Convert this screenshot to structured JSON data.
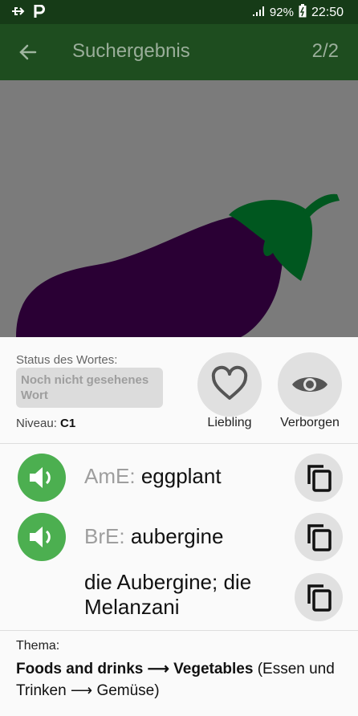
{
  "status_bar": {
    "icons": [
      "usb-icon",
      "parking-icon",
      "signal-icon",
      "battery-icon"
    ],
    "battery": "92%",
    "time": "22:50"
  },
  "app_bar": {
    "title": "Suchergebnis",
    "counter": "2/2"
  },
  "word_status": {
    "label": "Status des Wortes:",
    "value": "Noch nicht gesehenes Wort",
    "level_label": "Niveau:",
    "level_value": "C1"
  },
  "actions": {
    "favorite_label": "Liebling",
    "hidden_label": "Verborgen"
  },
  "translations": [
    {
      "prefix": "AmE:",
      "word": "eggplant"
    },
    {
      "prefix": "BrE:",
      "word": "aubergine"
    }
  ],
  "german": "die Aubergine; die Melanzani",
  "topic": {
    "label": "Thema:",
    "english": "Foods and drinks ⟶ Vegetables",
    "german": "(Essen und Trinken ⟶ Gemüse)"
  },
  "colors": {
    "status_bar": "#163b17",
    "app_bar": "#1e4d1f",
    "speaker_green": "#4caf50",
    "eggplant": "#2a0034",
    "stem": "#00571f"
  }
}
